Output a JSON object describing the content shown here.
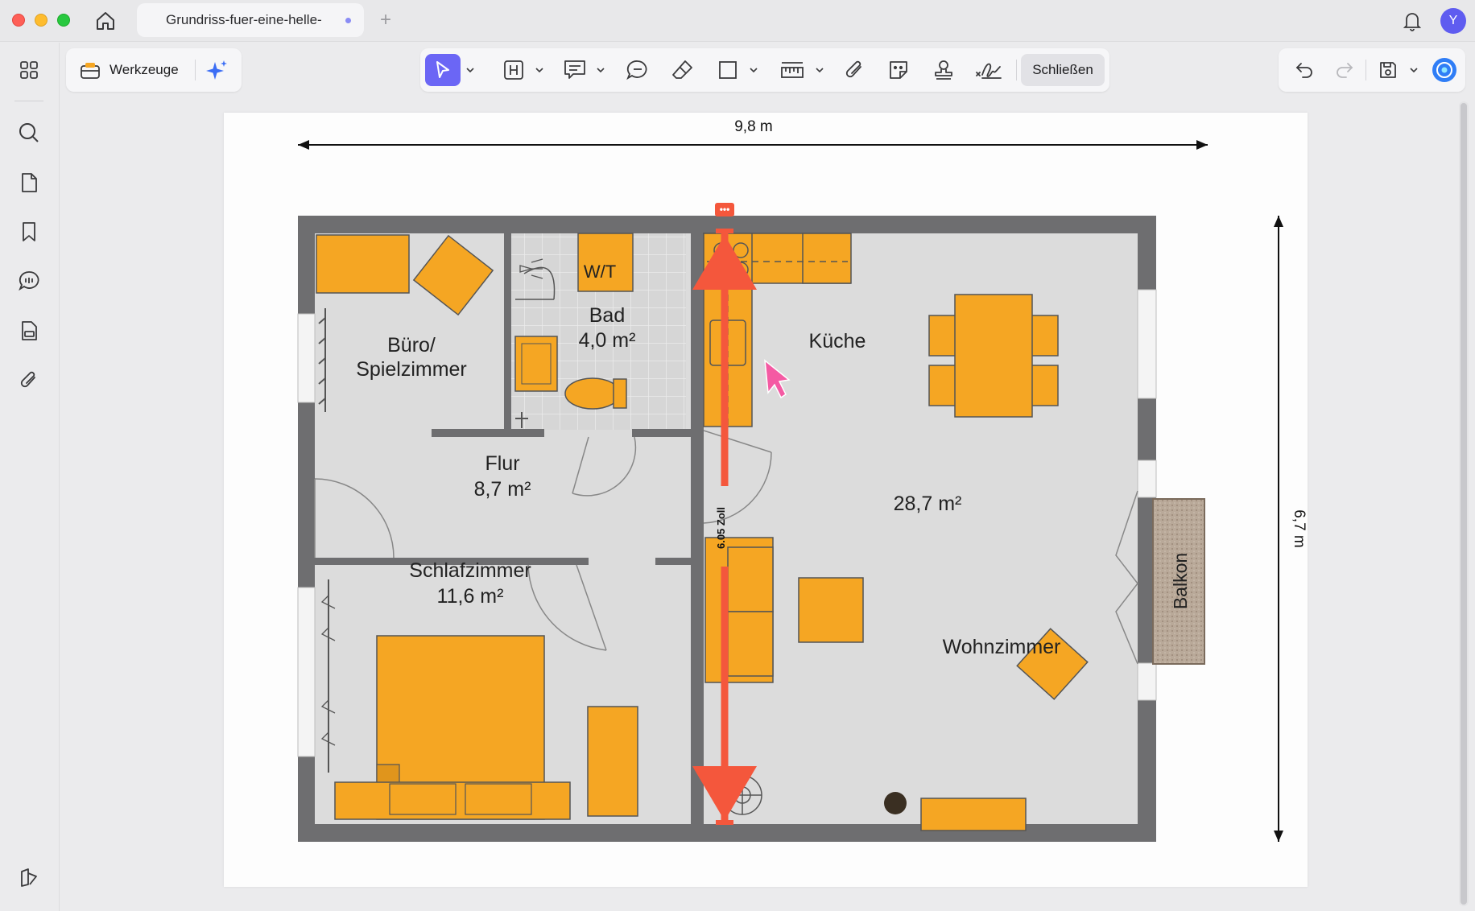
{
  "window": {
    "tab_title": "Grundriss-fuer-eine-helle-",
    "new_tab": "+",
    "avatar_initial": "Y"
  },
  "toolbar": {
    "tools_label": "Werkzeuge",
    "close_label": "Schließen"
  },
  "floorplan": {
    "width_label": "9,8 m",
    "height_label": "6,7 m",
    "measure_label": "6.05 Zoll",
    "measure_menu": "•••",
    "rooms": {
      "buero_line1": "Büro/",
      "buero_line2": "Spielzimmer",
      "bad_name": "Bad",
      "bad_area": "4,0 m²",
      "wt": "W/T",
      "kueche": "Küche",
      "flur_name": "Flur",
      "flur_area": "8,7 m²",
      "wohn_area": "28,7 m²",
      "schlaf_name": "Schlafzimmer",
      "schlaf_area": "11,6 m²",
      "wohnzimmer": "Wohnzimmer",
      "balkon": "Balkon"
    }
  },
  "colors": {
    "accent": "#6b66f5",
    "furniture": "#f5a623",
    "wall": "#6e6e70",
    "floor": "#dcdcdc",
    "measure": "#f4573c"
  }
}
